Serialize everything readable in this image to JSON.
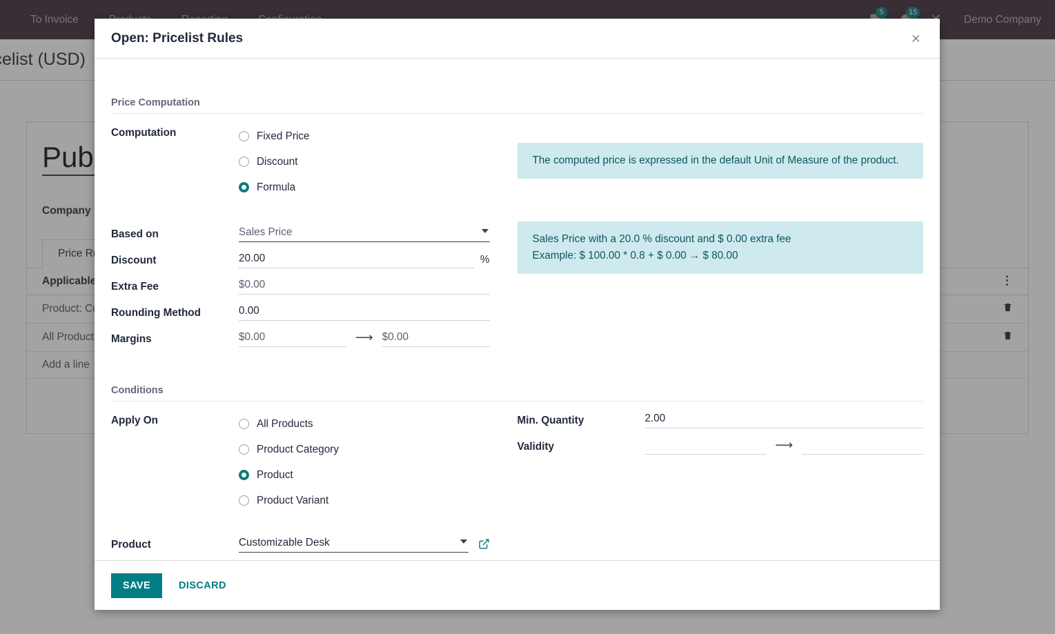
{
  "topbar": {
    "menu_items": [
      {
        "label": "To Invoice"
      },
      {
        "label": "Products"
      },
      {
        "label": "Reporting"
      },
      {
        "label": "Configuration"
      }
    ],
    "messages_badge": "5",
    "activities_badge": "15",
    "company": "Demo Company"
  },
  "background": {
    "breadcrumb": "Pricelist (USD)",
    "record_title": "Publ",
    "company_label": "Company",
    "tab_label": "Price Rul",
    "table": {
      "header": "Applicable",
      "rows": [
        {
          "label": "Product: Cu"
        },
        {
          "label": "All Product"
        }
      ],
      "add_line": "Add a line"
    }
  },
  "modal": {
    "title": "Open: Pricelist Rules",
    "close_label": "×",
    "price_computation": {
      "section_title": "Price Computation",
      "computation_label": "Computation",
      "computation_options": [
        {
          "label": "Fixed Price",
          "selected": false
        },
        {
          "label": "Discount",
          "selected": false
        },
        {
          "label": "Formula",
          "selected": true
        }
      ],
      "info_note": "The computed price is expressed in the default Unit of Measure of the product.",
      "based_on_label": "Based on",
      "based_on_value": "Sales Price",
      "discount_label": "Discount",
      "discount_value": "20.00",
      "discount_suffix": "%",
      "extra_fee_label": "Extra Fee",
      "extra_fee_value": "$0.00",
      "rounding_method_label": "Rounding Method",
      "rounding_method_value": "0.00",
      "margins_label": "Margins",
      "margins_min_value": "$0.00",
      "margins_max_value": "$0.00",
      "formula_note_line1": "Sales Price with a 20.0 % discount and $ 0.00 extra fee",
      "formula_note_line2": "Example: $ 100.00 * 0.8 + $ 0.00 → $ 80.00"
    },
    "conditions": {
      "section_title": "Conditions",
      "apply_on_label": "Apply On",
      "apply_on_options": [
        {
          "label": "All Products",
          "selected": false
        },
        {
          "label": "Product Category",
          "selected": false
        },
        {
          "label": "Product",
          "selected": true
        },
        {
          "label": "Product Variant",
          "selected": false
        }
      ],
      "product_label": "Product",
      "product_value": "Customizable Desk",
      "min_quantity_label": "Min. Quantity",
      "min_quantity_value": "2.00",
      "validity_label": "Validity",
      "validity_from_value": "",
      "validity_to_value": ""
    },
    "footer": {
      "save_label": "SAVE",
      "discard_label": "DISCARD"
    }
  },
  "colors": {
    "accent_teal": "#017e84",
    "topbar_plum": "#3c2b38",
    "alert_bg": "#cfeaee",
    "alert_text": "#0d5663"
  }
}
